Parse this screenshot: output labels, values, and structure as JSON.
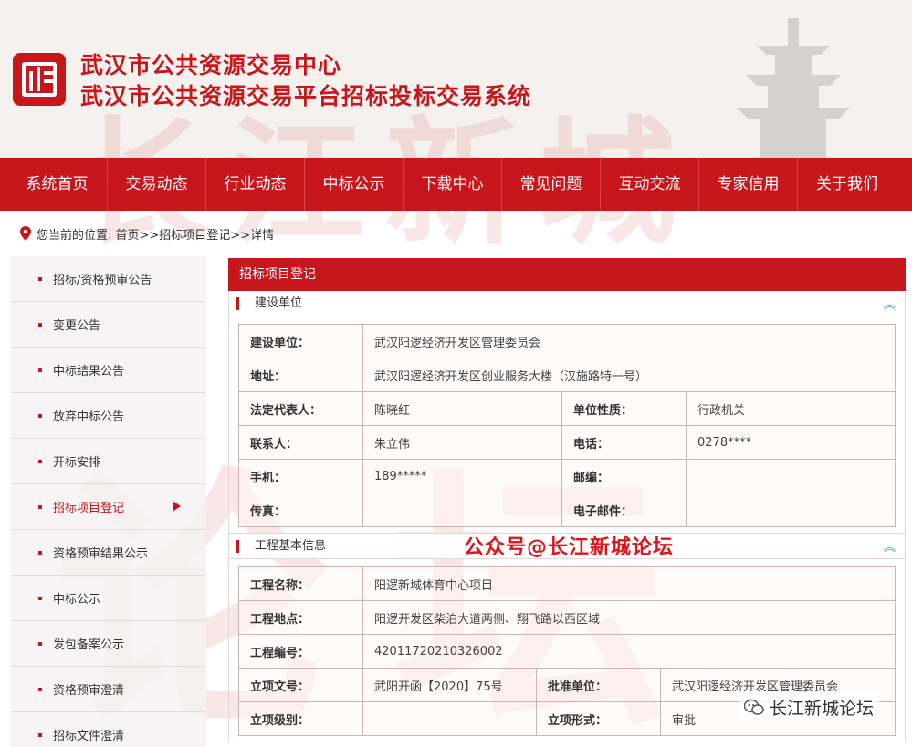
{
  "header": {
    "title_line1": "武汉市公共资源交易中心",
    "title_line2": "武汉市公共资源交易平台招标投标交易系统"
  },
  "nav": [
    "系统首页",
    "交易动态",
    "行业动态",
    "中标公示",
    "下载中心",
    "常见问题",
    "互动交流",
    "专家信用",
    "关于我们"
  ],
  "breadcrumb": "您当前的位置: 首页>>招标项目登记>>详情",
  "sidebar": [
    "招标/资格预审公告",
    "变更公告",
    "中标结果公告",
    "放弃中标公告",
    "开标安排",
    "招标项目登记",
    "资格预审结果公示",
    "中标公示",
    "发包备案公示",
    "资格预审澄清",
    "招标文件澄清"
  ],
  "panel_title": "招标项目登记",
  "section1": {
    "title": "建设单位",
    "collapse": "︽",
    "rows": {
      "unit_label": "建设单位：",
      "unit_value": "武汉阳逻经济开发区管理委员会",
      "addr_label": "地址：",
      "addr_value": "武汉阳逻经济开发区创业服务大楼（汉施路特一号）",
      "legal_label": "法定代表人：",
      "legal_value": "陈晓红",
      "nature_label": "单位性质：",
      "nature_value": "行政机关",
      "contact_label": "联系人：",
      "contact_value": "朱立伟",
      "phone_label": "电话：",
      "phone_value": "0278****",
      "mobile_label": "手机：",
      "mobile_value": "189*****",
      "zip_label": "邮编：",
      "zip_value": "",
      "fax_label": "传真：",
      "fax_value": "",
      "email_label": "电子邮件：",
      "email_value": ""
    }
  },
  "section2": {
    "title": "工程基本信息",
    "collapse": "︽",
    "rows": {
      "name_label": "工程名称：",
      "name_value": "阳逻新城体育中心项目",
      "loc_label": "工程地点：",
      "loc_value": "阳逻开发区柴泊大道两侧、翔飞路以西区域",
      "code_label": "工程编号：",
      "code_value": "42011720210326002",
      "doc_label": "立项文号：",
      "doc_value": "武阳开函【2020】75号",
      "approver_label": "批准单位：",
      "approver_value": "武汉阳逻经济开发区管理委员会",
      "level_label": "立项级别：",
      "level_value": "",
      "form_label": "立项形式：",
      "form_value": "审批"
    }
  },
  "watermarks": {
    "overlay": "公众号@长江新城论坛",
    "corner": "长江新城论坛",
    "bg_top": "长江新城",
    "bg_left": "论",
    "bg_right": "坛"
  },
  "colors": {
    "accent": "#c8161d",
    "nav_text": "#ffffff"
  }
}
